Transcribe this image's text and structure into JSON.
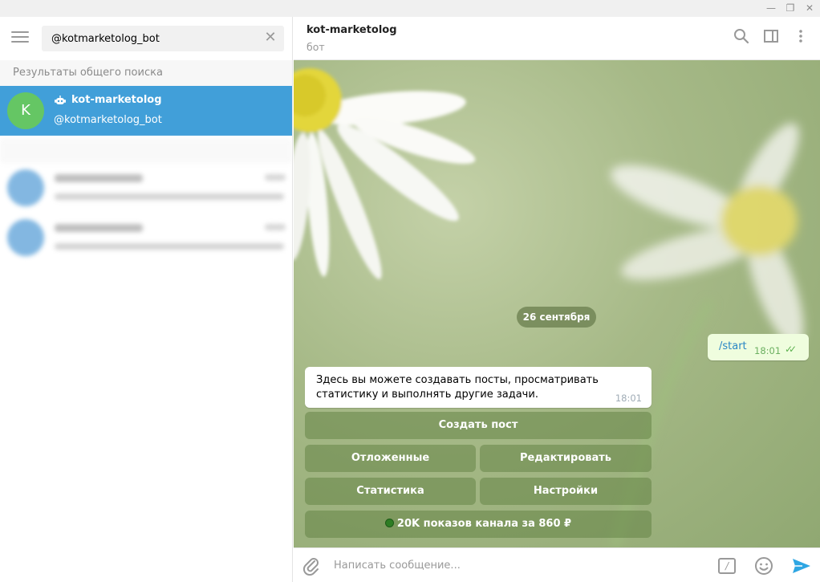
{
  "window": {
    "minimize_glyph": "—",
    "maximize_glyph": "❐",
    "close_glyph": "✕"
  },
  "search": {
    "value": "@kotmarketolog_bot",
    "clear_glyph": "✕"
  },
  "sidebar": {
    "global_results_header": "Результаты общего поиска",
    "result": {
      "avatar_letter": "K",
      "avatar_color": "#65c664",
      "name": "kot-marketolog",
      "handle": "@kotmarketolog_bot",
      "icon": "bot-icon"
    },
    "highlight_color": "#419fd9"
  },
  "chat": {
    "title": "kot-marketolog",
    "subtitle": "бот",
    "date_label": "26 сентября",
    "outgoing": {
      "text": "/start",
      "time": "18:01",
      "status_glyph": "✓✓"
    },
    "incoming": {
      "text": "Здесь вы можете создавать посты, просматривать статистику и выполнять другие задачи.",
      "time": "18:01"
    },
    "keyboard": {
      "create_post": "Создать пост",
      "scheduled": "Отложенные",
      "edit": "Редактировать",
      "stats": "Статистика",
      "settings": "Настройки",
      "promo": "20K показов канала за 860 ₽"
    }
  },
  "composer": {
    "placeholder": "Написать сообщение...",
    "command_glyph": "/"
  },
  "colors": {
    "accent": "#419fd9",
    "outgoing_bubble": "#effdde",
    "send_icon": "#2ea6e3"
  }
}
